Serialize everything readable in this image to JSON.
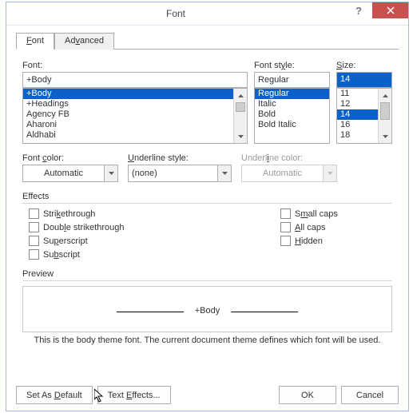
{
  "titlebar": {
    "title": "Font"
  },
  "tabs": {
    "font": "Font",
    "advanced": "Advanced"
  },
  "font": {
    "label": "Font:",
    "value": "+Body",
    "items": [
      "+Body",
      "+Headings",
      "Agency FB",
      "Aharoni",
      "Aldhabi"
    ]
  },
  "style": {
    "label": "Font style:",
    "value": "Regular",
    "items": [
      "Regular",
      "Italic",
      "Bold",
      "Bold Italic"
    ]
  },
  "size": {
    "label": "Size:",
    "value": "14",
    "items": [
      "11",
      "12",
      "14",
      "16",
      "18"
    ]
  },
  "fontcolor": {
    "label": "Font color:",
    "value": "Automatic"
  },
  "underlinestyle": {
    "label": "Underline style:",
    "value": "(none)"
  },
  "underlinecolor": {
    "label": "Underline color:",
    "value": "Automatic"
  },
  "effects": {
    "label": "Effects",
    "strike": "Strikethrough",
    "dstrike": "Double strikethrough",
    "super": "Superscript",
    "sub": "Subscript",
    "smallcaps": "Small caps",
    "allcaps": "All caps",
    "hidden": "Hidden"
  },
  "preview": {
    "label": "Preview",
    "value": "+Body",
    "note": "This is the body theme font. The current document theme defines which font will be used."
  },
  "buttons": {
    "setdefault": "Set As Default",
    "texteffects": "Text Effects...",
    "ok": "OK",
    "cancel": "Cancel"
  }
}
